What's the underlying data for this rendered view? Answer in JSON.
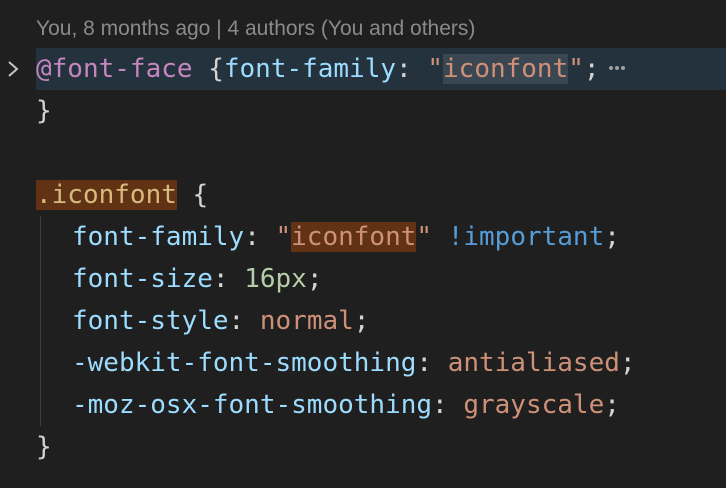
{
  "blame": {
    "text": "You, 8 months ago | 4 authors (You and others)"
  },
  "code": {
    "line1": {
      "at_rule": "@font-face",
      "open_brace": " {",
      "prop": "font-family",
      "colon": ": ",
      "quote_open": "\"",
      "value": "iconfont",
      "quote_close": "\"",
      "semicolon": ";"
    },
    "line2": {
      "close_brace": "}"
    },
    "line4": {
      "dot": ".",
      "selector": "iconfont",
      "open_brace": " {"
    },
    "line5": {
      "prop": "font-family",
      "colon": ": ",
      "quote_open": "\"",
      "value": "iconfont",
      "quote_close": "\"",
      "important": " !important",
      "semicolon": ";"
    },
    "line6": {
      "prop": "font-size",
      "colon": ": ",
      "value": "16px",
      "semicolon": ";"
    },
    "line7": {
      "prop": "font-style",
      "colon": ": ",
      "value": "normal",
      "semicolon": ";"
    },
    "line8": {
      "prop": "-webkit-font-smoothing",
      "colon": ": ",
      "value": "antialiased",
      "semicolon": ";"
    },
    "line9": {
      "prop": "-moz-osx-font-smoothing",
      "colon": ": ",
      "value": "grayscale",
      "semicolon": ";"
    },
    "line10": {
      "close_brace": "}"
    }
  },
  "colors": {
    "background": "#1f1f1f",
    "property": "#9cdcfe",
    "string": "#ce9178",
    "number": "#b5cea8",
    "keyword": "#c586c0",
    "selector": "#d7ba7d",
    "important": "#569cd6"
  },
  "icons": {
    "fold": "chevron-right-icon",
    "folded": "ellipsis-icon"
  }
}
